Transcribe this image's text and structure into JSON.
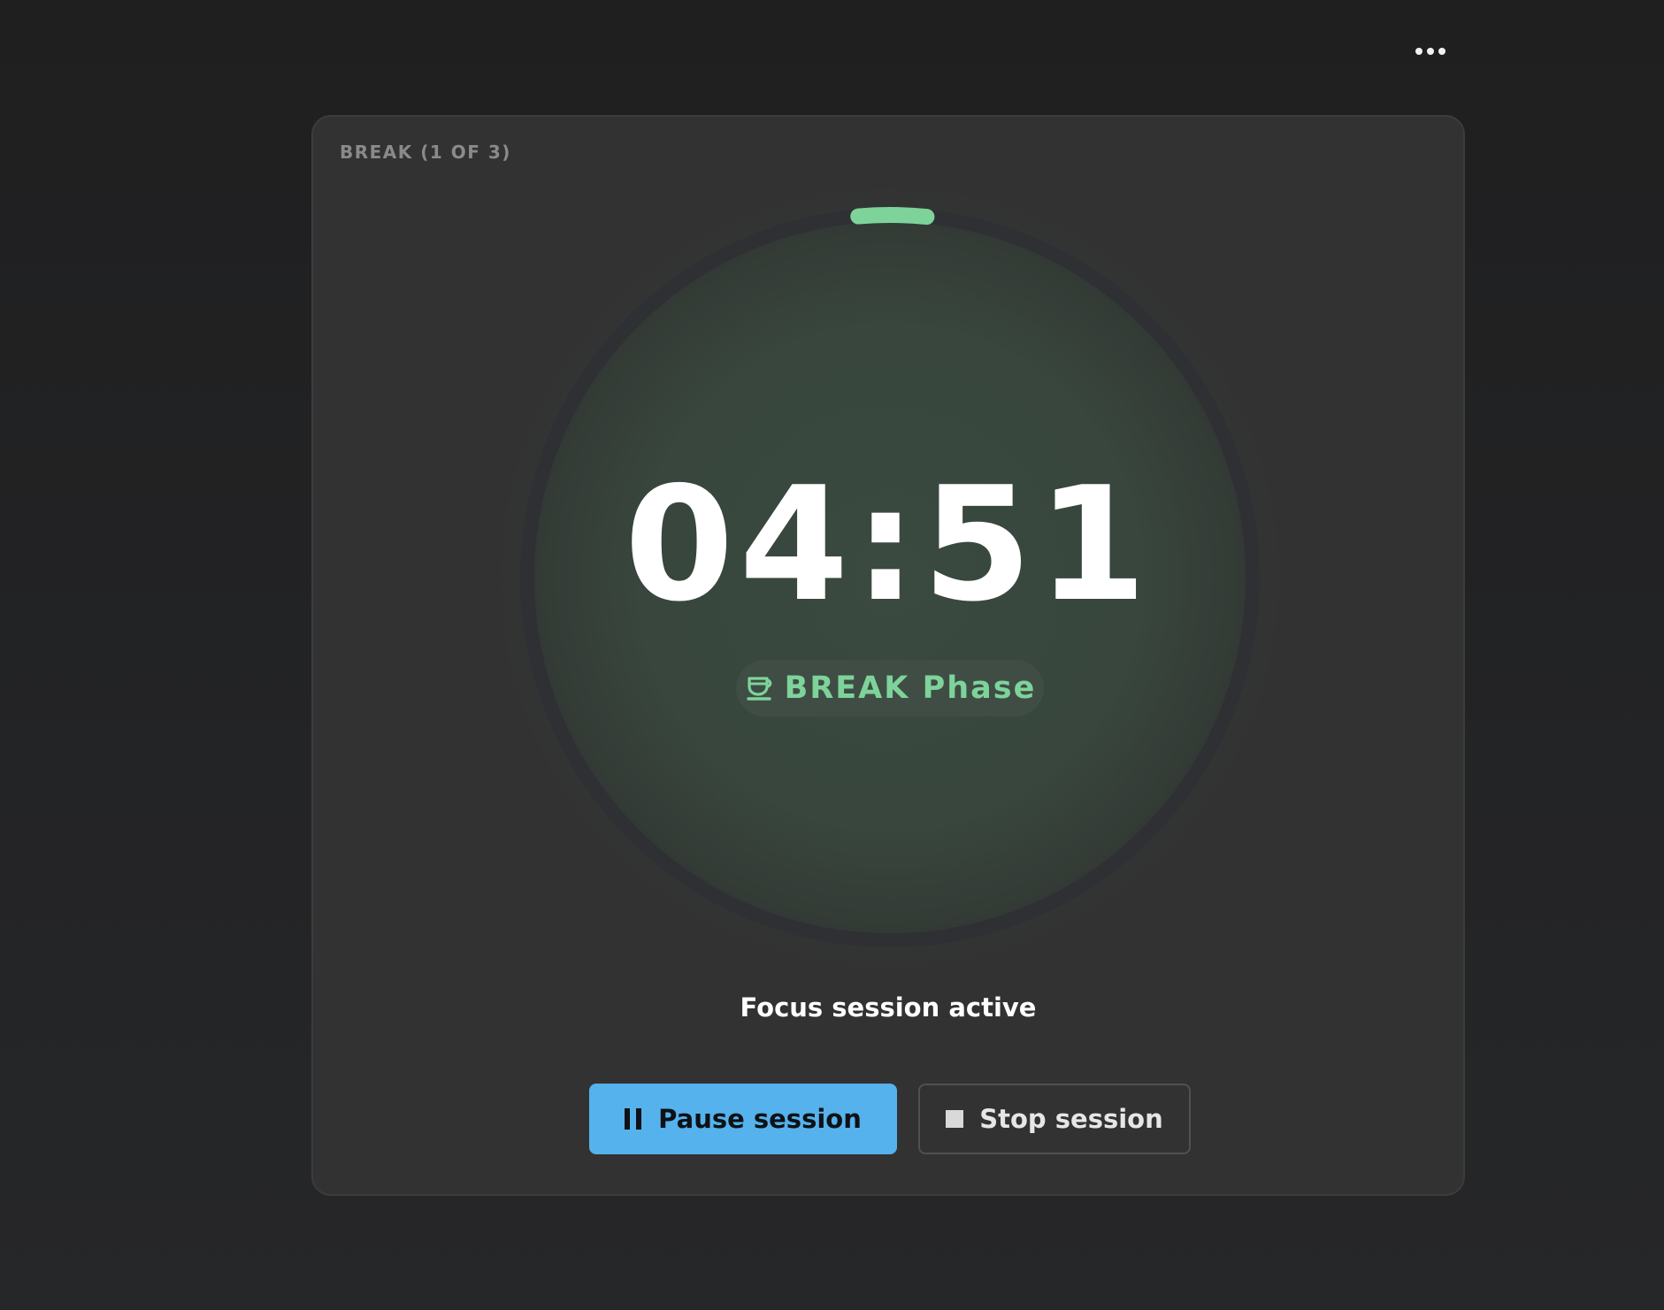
{
  "header": {
    "more_icon": "more-horizontal-icon"
  },
  "card": {
    "label": "BREAK (1 OF 3)",
    "timer": {
      "time": "04:51",
      "progress_fraction": 0.03,
      "phase_icon": "coffee-cup-icon",
      "phase_label": "BREAK Phase"
    },
    "status": "Focus session active",
    "actions": {
      "pause": {
        "label": "Pause session",
        "icon": "pause-icon"
      },
      "stop": {
        "label": "Stop session",
        "icon": "stop-icon"
      }
    }
  },
  "colors": {
    "background": "#222223",
    "card": "#323232",
    "accent_green": "#7ed39b",
    "primary_blue": "#55b2ec",
    "ring_track": "#2f3034"
  }
}
